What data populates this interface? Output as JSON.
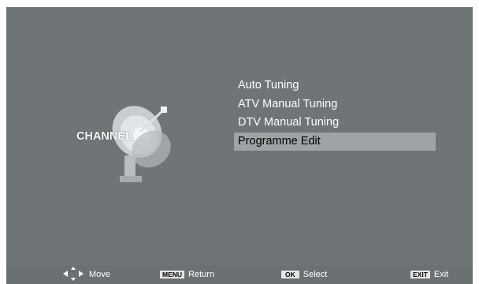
{
  "sidebar": {
    "label": "CHANNEL"
  },
  "menu": {
    "items": [
      {
        "label": "Auto Tuning",
        "selected": false
      },
      {
        "label": "ATV Manual Tuning",
        "selected": false
      },
      {
        "label": "DTV Manual Tuning",
        "selected": false
      },
      {
        "label": "Programme Edit",
        "selected": true
      }
    ]
  },
  "footer": {
    "move": {
      "icon": "dpad-arrows-icon",
      "label": "Move"
    },
    "return": {
      "key": "MENU",
      "label": "Return"
    },
    "select": {
      "key": "OK",
      "label": "Select"
    },
    "exit": {
      "key": "EXIT",
      "label": "Exit"
    }
  },
  "colors": {
    "background": "#6f7477",
    "highlight": "#9fa3a6",
    "text": "#ffffff"
  }
}
